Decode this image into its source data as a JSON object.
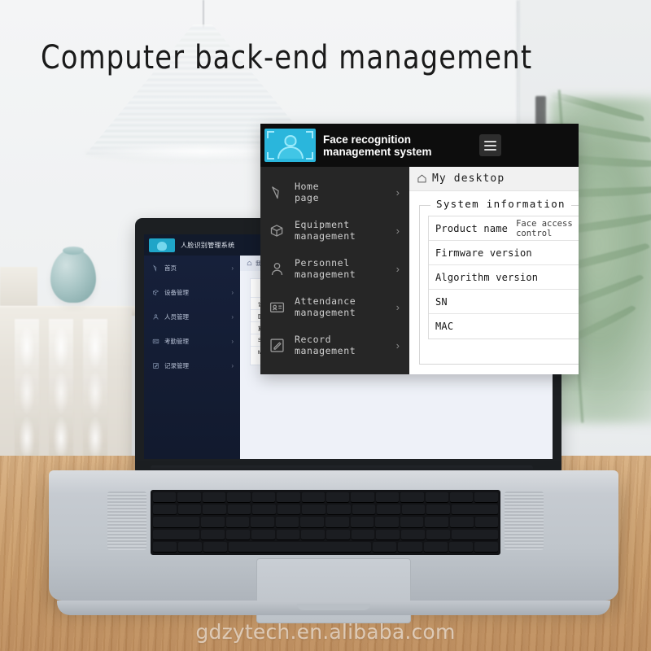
{
  "page": {
    "headline": "Computer back-end management",
    "watermark": "gdzytech.en.alibaba.com"
  },
  "overlay_app": {
    "header": {
      "logo_icon": "face-recognition-logo-icon",
      "title": "Face recognition management system",
      "menu_toggle_icon": "hamburger-menu-icon"
    },
    "sidebar": {
      "items": [
        {
          "label": "Home\npage",
          "icon": "paper-plane-icon",
          "arrow": "›"
        },
        {
          "label": "Equipment\nmanagement",
          "icon": "box-icon",
          "arrow": "›"
        },
        {
          "label": "Personnel\nmanagement",
          "icon": "person-icon",
          "arrow": "›"
        },
        {
          "label": "Attendance\nmanagement",
          "icon": "id-card-icon",
          "arrow": "›"
        },
        {
          "label": "Record\nmanagement",
          "icon": "edit-square-icon",
          "arrow": "›"
        }
      ]
    },
    "breadcrumb": {
      "home_icon": "home-outline-icon",
      "text": "My desktop"
    },
    "panel": {
      "legend": "System information",
      "rows": [
        {
          "key": "Product name",
          "value": "Face access\ncontrol"
        },
        {
          "key": "Firmware version",
          "value": ""
        },
        {
          "key": "Algorithm version",
          "value": ""
        },
        {
          "key": "SN",
          "value": ""
        },
        {
          "key": "MAC",
          "value": ""
        }
      ]
    },
    "colors": {
      "header_bg": "#0d0d0d",
      "sidebar_bg": "#262626",
      "panel_bg": "#ffffff",
      "logo_accent": "#2ab6dc",
      "breadcrumb_bg": "#f1f1f1"
    }
  },
  "laptop_screen_app": {
    "header": {
      "title": "人脸识别管理系统",
      "logo_icon": "face-recognition-logo-icon",
      "menu_toggle_icon": "hamburger-menu-icon"
    },
    "sidebar": {
      "items": [
        {
          "label": "首页",
          "arrow": "›"
        },
        {
          "label": "设备管理",
          "arrow": "›"
        },
        {
          "label": "人员管理",
          "arrow": "›"
        },
        {
          "label": "考勤管理",
          "arrow": "›"
        },
        {
          "label": "记录管理",
          "arrow": "›"
        }
      ]
    },
    "breadcrumb": {
      "text": "我的桌面"
    },
    "panel": {
      "legend": "系统信息",
      "rows": [
        {
          "key": "设备名称"
        },
        {
          "key": "固件版本"
        },
        {
          "key": "算法版本"
        },
        {
          "key": "SN"
        },
        {
          "key": "MAC"
        }
      ]
    },
    "colors": {
      "header_bg": "#121a2b",
      "sidebar_bg": "#16203a",
      "accent": "#1fa5c8"
    }
  },
  "scene": {
    "description_objects": [
      "pendant-lamp",
      "ceramic-vase",
      "sideboard",
      "palm-plant",
      "wooden-desk",
      "silver-laptop"
    ]
  }
}
